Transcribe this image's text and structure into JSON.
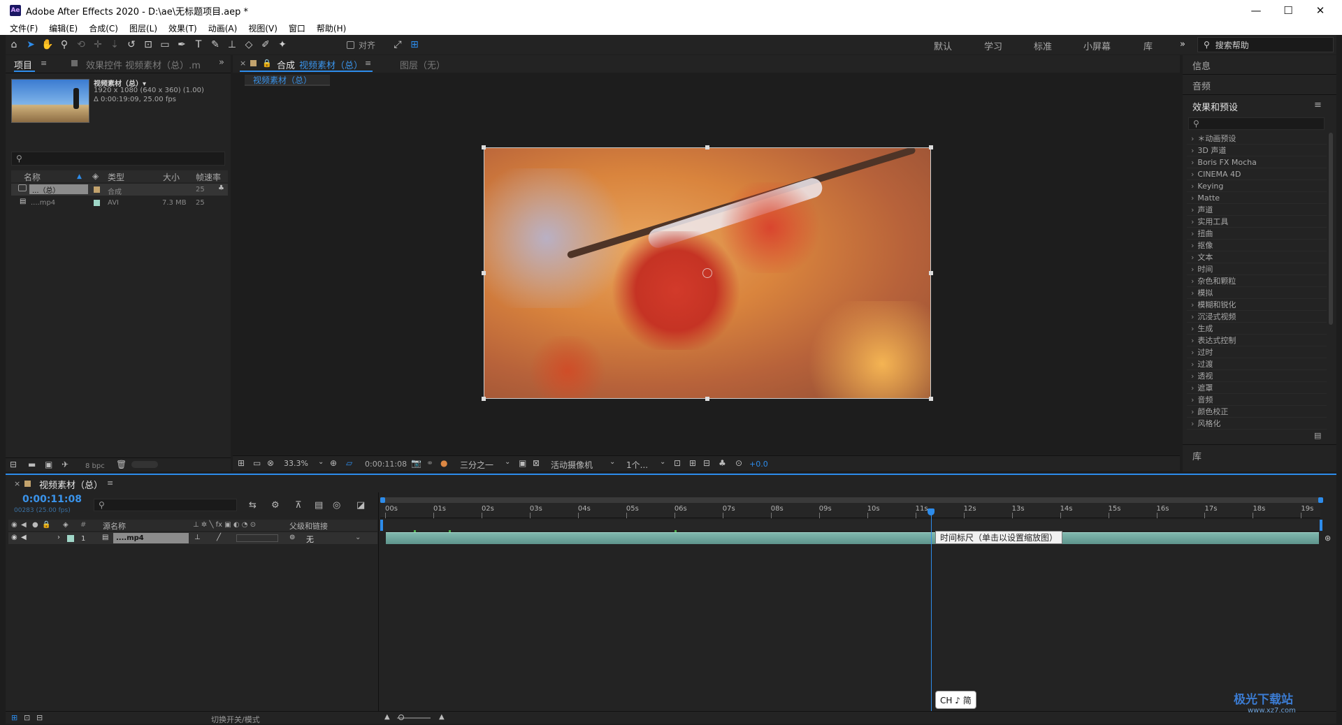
{
  "window": {
    "title": "Adobe After Effects 2020 - D:\\ae\\无标题项目.aep *",
    "logo": "Ae",
    "minimize": "—",
    "maximize": "☐",
    "close": "✕"
  },
  "menu": [
    "文件(F)",
    "编辑(E)",
    "合成(C)",
    "图层(L)",
    "效果(T)",
    "动画(A)",
    "视图(V)",
    "窗口",
    "帮助(H)"
  ],
  "toolbar": {
    "tools": [
      "home-icon",
      "selection-tool-icon",
      "hand-tool-icon",
      "zoom-tool-icon",
      "orbit-camera-icon",
      "pan-camera-icon",
      "dolly-camera-icon",
      "rotation-tool-icon",
      "pan-behind-tool-icon",
      "rectangle-tool-icon",
      "pen-tool-icon",
      "type-tool-icon",
      "brush-tool-icon",
      "clone-stamp-icon",
      "eraser-tool-icon",
      "roto-brush-icon",
      "puppet-pin-icon"
    ],
    "align_label": "对齐",
    "workspaces": [
      "默认",
      "学习",
      "标准",
      "小屏幕",
      "库"
    ],
    "more": "»",
    "search_help": "搜索帮助"
  },
  "project_panel": {
    "tab_project": "项目",
    "tab_effect_controls": "效果控件 视频素材（总）.mp",
    "preview_name": "视频素材（总）▾",
    "preview_info1": "1920 x 1080  (640 x 360) (1.00)",
    "preview_info2": "Δ 0:00:19:09, 25.00 fps",
    "search_placeholder": "",
    "columns": [
      "名称",
      "类型",
      "大小",
      "帧速率"
    ],
    "items": [
      {
        "name": "...（总）",
        "type": "合成",
        "size": "",
        "fps": "25",
        "color": "#c3a36d"
      },
      {
        "name": "....mp4",
        "type": "AVI",
        "size": "7.3 MB",
        "fps": "25",
        "color": "#9fd6c7"
      }
    ],
    "bpc": "8 bpc"
  },
  "composition_panel": {
    "tab_close": "×",
    "tab_prefix": "合成",
    "tab_name": "视频素材（总）",
    "layer_tab": "图层（无）",
    "breadcrumb": "视频素材（总）",
    "zoom": "33.3%",
    "timecode": "0:00:11:08",
    "resolution": "三分之一",
    "camera": "活动摄像机",
    "views": "1个...",
    "exposure": "+0.0"
  },
  "right_panel": {
    "info": "信息",
    "audio": "音频",
    "effects_title": "效果和预设",
    "search_placeholder": "",
    "effects": [
      "＊动画预设",
      "3D 声道",
      "Boris FX Mocha",
      "CINEMA 4D",
      "Keying",
      "Matte",
      "声道",
      "实用工具",
      "扭曲",
      "抠像",
      "文本",
      "时间",
      "杂色和颗粒",
      "模拟",
      "模糊和锐化",
      "沉浸式视频",
      "生成",
      "表达式控制",
      "过时",
      "过渡",
      "透视",
      "遮罩",
      "音频",
      "颜色校正",
      "风格化"
    ],
    "library": "库"
  },
  "timeline": {
    "tab_name": "视频素材（总）",
    "timecode": "0:00:11:08",
    "frame_info": "00283 (25.00 fps)",
    "col_source": "源名称",
    "col_parent": "父级和链接",
    "layer_index": "1",
    "layer_name": "....mp4",
    "parent_value": "无",
    "ruler": [
      "00s",
      "01s",
      "02s",
      "03s",
      "04s",
      "05s",
      "06s",
      "07s",
      "08s",
      "09s",
      "10s",
      "11s",
      "12s",
      "13s",
      "14s",
      "15s",
      "16s",
      "17s",
      "18s",
      "19s"
    ],
    "playhead_seconds": 11.32,
    "duration_seconds": 19.36,
    "tooltip": "时间标尺（单击以设置缩放图）",
    "toggle_modes": "切换开关/模式"
  },
  "ime": "CH ♪ 简",
  "watermark": {
    "text": "极光下载站",
    "url": "www.xz7.com"
  }
}
